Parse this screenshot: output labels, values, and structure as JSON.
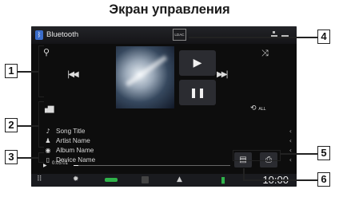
{
  "heading": "Экран управления",
  "header": {
    "source_label": "Bluetooth",
    "codec_badge": "LDAC",
    "bt_icon": "bluetooth-icon"
  },
  "controls": {
    "search_icon": "search-icon",
    "prev_icon": "previous-track-icon",
    "next_icon": "next-track-icon",
    "play_icon": "play-icon",
    "pause_icon": "pause-icon",
    "shuffle_icon": "shuffle-icon",
    "repeat_label": "ALL",
    "eq_icon": "equalizer-icon"
  },
  "info": {
    "rows": [
      {
        "icon": "music-note-icon",
        "label": "Song Title"
      },
      {
        "icon": "artist-icon",
        "label": "Artist Name"
      },
      {
        "icon": "album-icon",
        "label": "Album Name"
      },
      {
        "icon": "device-icon",
        "label": "Device Name"
      }
    ]
  },
  "progress": {
    "time": "0:05:01",
    "position": 0.03
  },
  "clock": "10:00",
  "markers": [
    "1",
    "2",
    "3",
    "4",
    "5",
    "6"
  ],
  "colors": {
    "screen_bg": "#0d0d0d",
    "accent_green": "#2fb34a",
    "bluetooth_blue": "#3a6cc9"
  }
}
